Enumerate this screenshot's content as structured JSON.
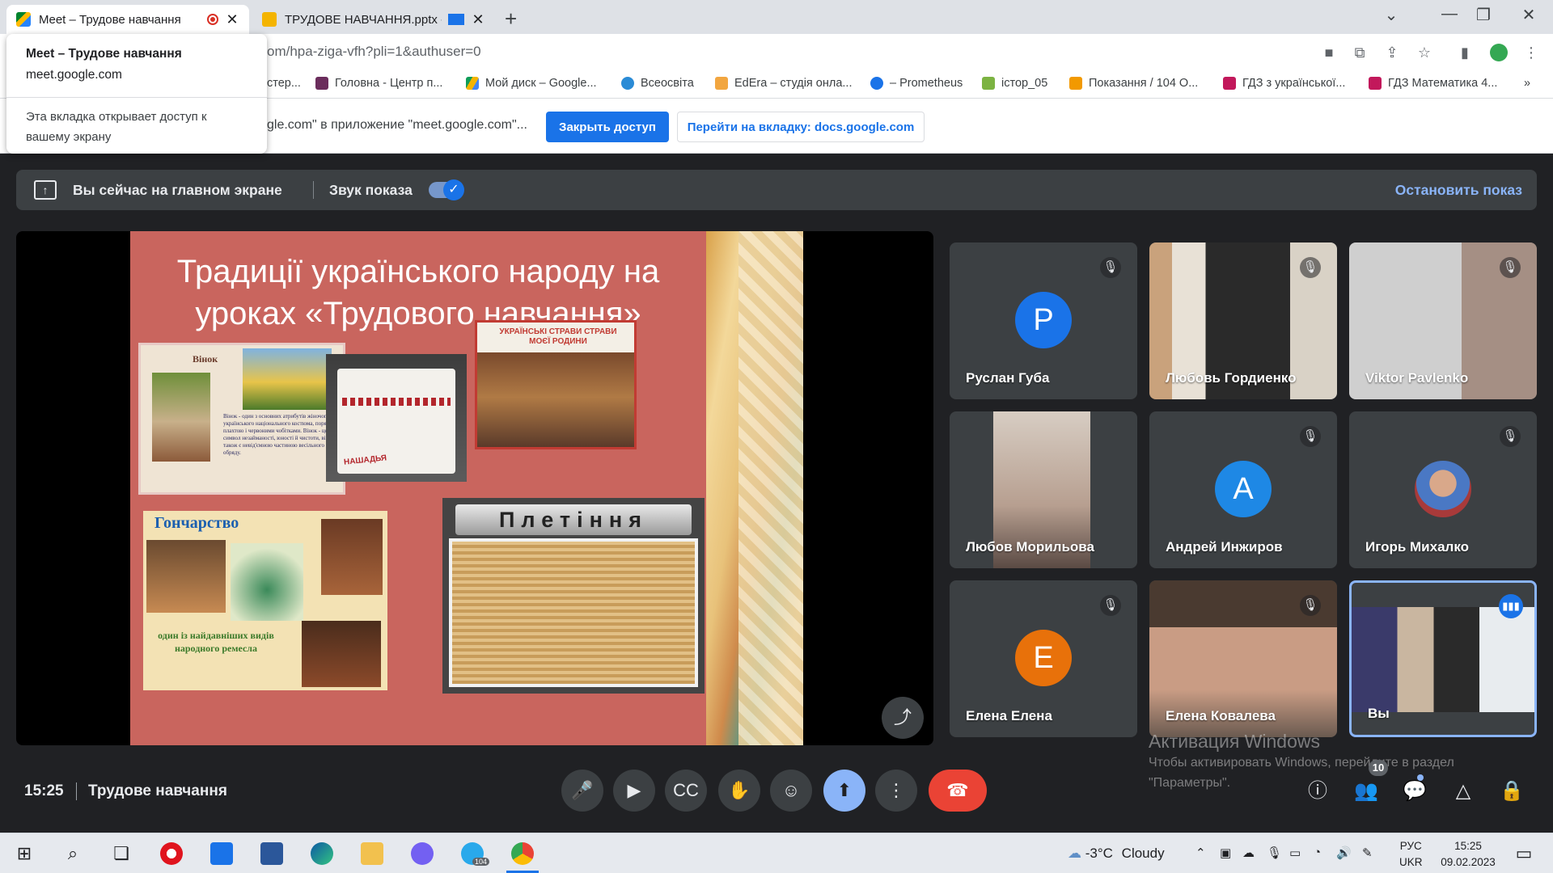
{
  "browser": {
    "tabs": [
      {
        "title": "Meet – Трудове навчання"
      },
      {
        "title": "ТРУДОВЕ НАВЧАННЯ.pptx -"
      }
    ],
    "new_tab": "+",
    "url": "om/hpa-ziga-vfh?pli=1&authuser=0",
    "bookmarks": [
      "стер...",
      "Головна - Центр п...",
      "Мой диск – Google...",
      "Всеосвіта",
      "EdEra – студія онла...",
      "– Prometheus",
      "істор_05",
      "Показання / 104 О...",
      "ГДЗ з української...",
      "ГДЗ Математика 4..."
    ],
    "more_bookmarks": "»",
    "infobar": {
      "text": "gle.com\" в приложение \"meet.google.com\"...",
      "stop_button": "Закрыть доступ",
      "goto_button": "Перейти на вкладку: docs.google.com"
    },
    "hovercard": {
      "title": "Meet – Трудове навчання",
      "domain": "meet.google.com",
      "note": "Эта вкладка открывает доступ к вашему экрану"
    }
  },
  "meet": {
    "banner": {
      "text": "Вы сейчас на главном экране",
      "sound_label": "Звук показа",
      "stop_link": "Остановить показ"
    },
    "slide": {
      "title": "Традиції українського народу на уроках «Трудового навчання»",
      "vinok_label": "Вінок",
      "vinok_text": "Вінок - один з основних атрибутів жіночого українського національного костюма, поряд з плахтою і червоними чобітками. Вінок - це символ незайманості, юності й чистоти, він ж також є невід'ємною частиною весільного обряду.",
      "dishes_label": "УКРАЇНСЬКІ СТРАВИ СТРАВИ МОЄЇ РОДИНИ",
      "pottery_label": "Гончарство",
      "pottery_caption": "один із найдавніших видів народного ремесла",
      "weaving_label": "Плетіння",
      "towel_text": "НАШАДЬЯ"
    },
    "participants": [
      {
        "name": "Руслан Губа",
        "initial": "P",
        "avatar_color": "#1a73e8",
        "muted": true
      },
      {
        "name": "Любовь Гордиенко",
        "muted": true
      },
      {
        "name": "Viktor Pavlenko",
        "muted": true
      },
      {
        "name": "Любов Морильова",
        "muted": false
      },
      {
        "name": "Андрей Инжиров",
        "initial": "A",
        "avatar_color": "#1e88e5",
        "muted": true
      },
      {
        "name": "Игорь Михалко",
        "muted": true
      },
      {
        "name": "Елена Елена",
        "initial": "E",
        "avatar_color": "#e8710a",
        "muted": true
      },
      {
        "name": "Елена Ковалева",
        "muted": true
      },
      {
        "name": "Вы",
        "speaking": true
      }
    ],
    "footer": {
      "time": "15:25",
      "meeting_title": "Трудове навчання",
      "participants_count": "10"
    },
    "activation": {
      "title": "Активация Windows",
      "text": "Чтобы активировать Windows, перейдите в раздел \"Параметры\"."
    }
  },
  "taskbar": {
    "weather_temp": "-3°C",
    "weather_text": "Cloudy",
    "lang_top": "РУС",
    "lang_bottom": "UKR",
    "time": "15:25",
    "date": "09.02.2023",
    "telegram_badge": "104"
  },
  "colors": {
    "meet_bg": "#202124",
    "accent_blue": "#8ab4f8",
    "end_call_red": "#ea4335",
    "slide_bg": "#c9655e"
  }
}
